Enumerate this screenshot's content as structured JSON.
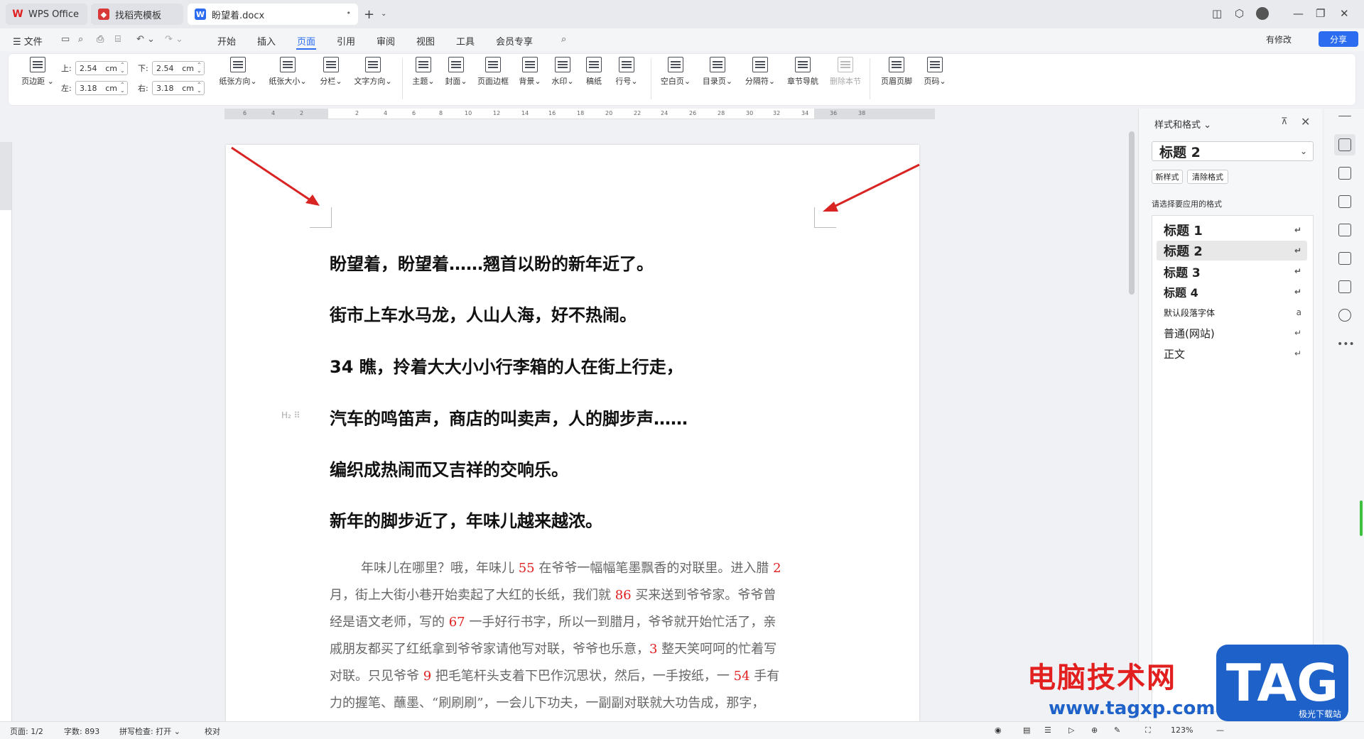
{
  "tabs": {
    "wps_label": "WPS Office",
    "template_label": "找稻壳模板",
    "doc_label": "盼望着.docx",
    "doc_close": "•",
    "new_tab": "+",
    "more": "⌄"
  },
  "menu": {
    "file": "☰ 文件",
    "items": [
      "开始",
      "插入",
      "页面",
      "引用",
      "审阅",
      "视图",
      "工具",
      "会员专享"
    ],
    "active": "页面",
    "changes": "有修改",
    "share": "分享"
  },
  "ribbon": {
    "page_margin": "页边距",
    "margin_top_label": "上:",
    "margin_top": "2.54",
    "margin_bottom_label": "下:",
    "margin_bottom": "2.54",
    "margin_left_label": "左:",
    "margin_left": "3.18",
    "margin_right_label": "右:",
    "margin_right": "3.18",
    "unit": "cm",
    "buttons": [
      "纸张方向",
      "纸张大小",
      "分栏",
      "文字方向",
      "主题",
      "封面",
      "页面边框",
      "背景",
      "水印",
      "稿纸",
      "行号",
      "空白页",
      "目录页",
      "分隔符",
      "章节导航",
      "删除本节",
      "页眉页脚",
      "页码"
    ]
  },
  "ruler": {
    "ticks": [
      "6",
      "4",
      "2",
      "2",
      "4",
      "6",
      "8",
      "10",
      "12",
      "14",
      "16",
      "18",
      "20",
      "22",
      "24",
      "26",
      "28",
      "30",
      "32",
      "34",
      "36",
      "38"
    ]
  },
  "document": {
    "headings": [
      "盼望着，盼望着……翘首以盼的新年近了。",
      "街市上车水马龙，人山人海，好不热闹。",
      "34 瞧，拎着大大小小行李箱的人在街上行走，",
      "汽车的鸣笛声，商店的叫卖声，人的脚步声……",
      "编织成热闹而又吉祥的交响乐。",
      "新年的脚步近了，年味儿越来越浓。"
    ],
    "heading_marker": "H₂ ⠿",
    "body": {
      "l1a": "年味儿在哪里？哦，年味儿 ",
      "l1n1": "55",
      "l1b": " 在爷爷一幅幅笔墨飘香的对联里。进入腊 ",
      "l1n2": "2",
      "l2a": "月，街上大街小巷开始卖起了大红的长纸，我们就 ",
      "l2n1": "86",
      "l2b": " 买来送到爷爷家。爷爷曾",
      "l3a": "经是语文老师，写的 ",
      "l3n1": "67",
      "l3b": " 一手好行书字，所以一到腊月，爷爷就开始忙活了，亲",
      "l4a": "戚朋友都买了红纸拿到爷爷家请他写对联，爷爷也乐意，",
      "l4n1": "3",
      "l4b": " 整天笑呵呵的忙着写",
      "l5a": "对联。只见爷爷 ",
      "l5n1": "9",
      "l5b": " 把毛笔杆头支着下巴作沉思状，然后，一手按纸，一 ",
      "l5n2": "54",
      "l5c": " 手有",
      "l6a": "力的握笔、蘸墨、“刷刷刷”，一会儿下功夫，一副副对联就大功告成，那字，"
    }
  },
  "style_panel": {
    "title": "样式和格式 ⌄",
    "pin": "⊼",
    "close": "✕",
    "current": "标题 2",
    "new_style": "新样式",
    "clear_format": "清除格式",
    "apply_label": "请选择要应用的格式",
    "styles": [
      {
        "name": "标题 1",
        "mark": "↵"
      },
      {
        "name": "标题 2",
        "mark": "↵"
      },
      {
        "name": "标题 3",
        "mark": "↵"
      },
      {
        "name": "标题 4",
        "mark": "↵"
      },
      {
        "name": "默认段落字体",
        "mark": "a"
      },
      {
        "name": "普通(网站)",
        "mark": "↵"
      },
      {
        "name": "正文",
        "mark": "↵"
      }
    ]
  },
  "status": {
    "page": "页面: 1/2",
    "words": "字数: 893",
    "spell": "拼写检查: 打开 ⌄",
    "proof": "校对",
    "zoom": "123%",
    "zoom_minus": "—",
    "zoom_plus": "+"
  },
  "watermark": {
    "text": "电脑技术网",
    "url": "www.tagxp.com",
    "tag": "TAG",
    "site": "极光下载站"
  },
  "colors": {
    "accent": "#2b6cf0",
    "number_red": "#e02020",
    "arrow_red": "#d92424"
  }
}
